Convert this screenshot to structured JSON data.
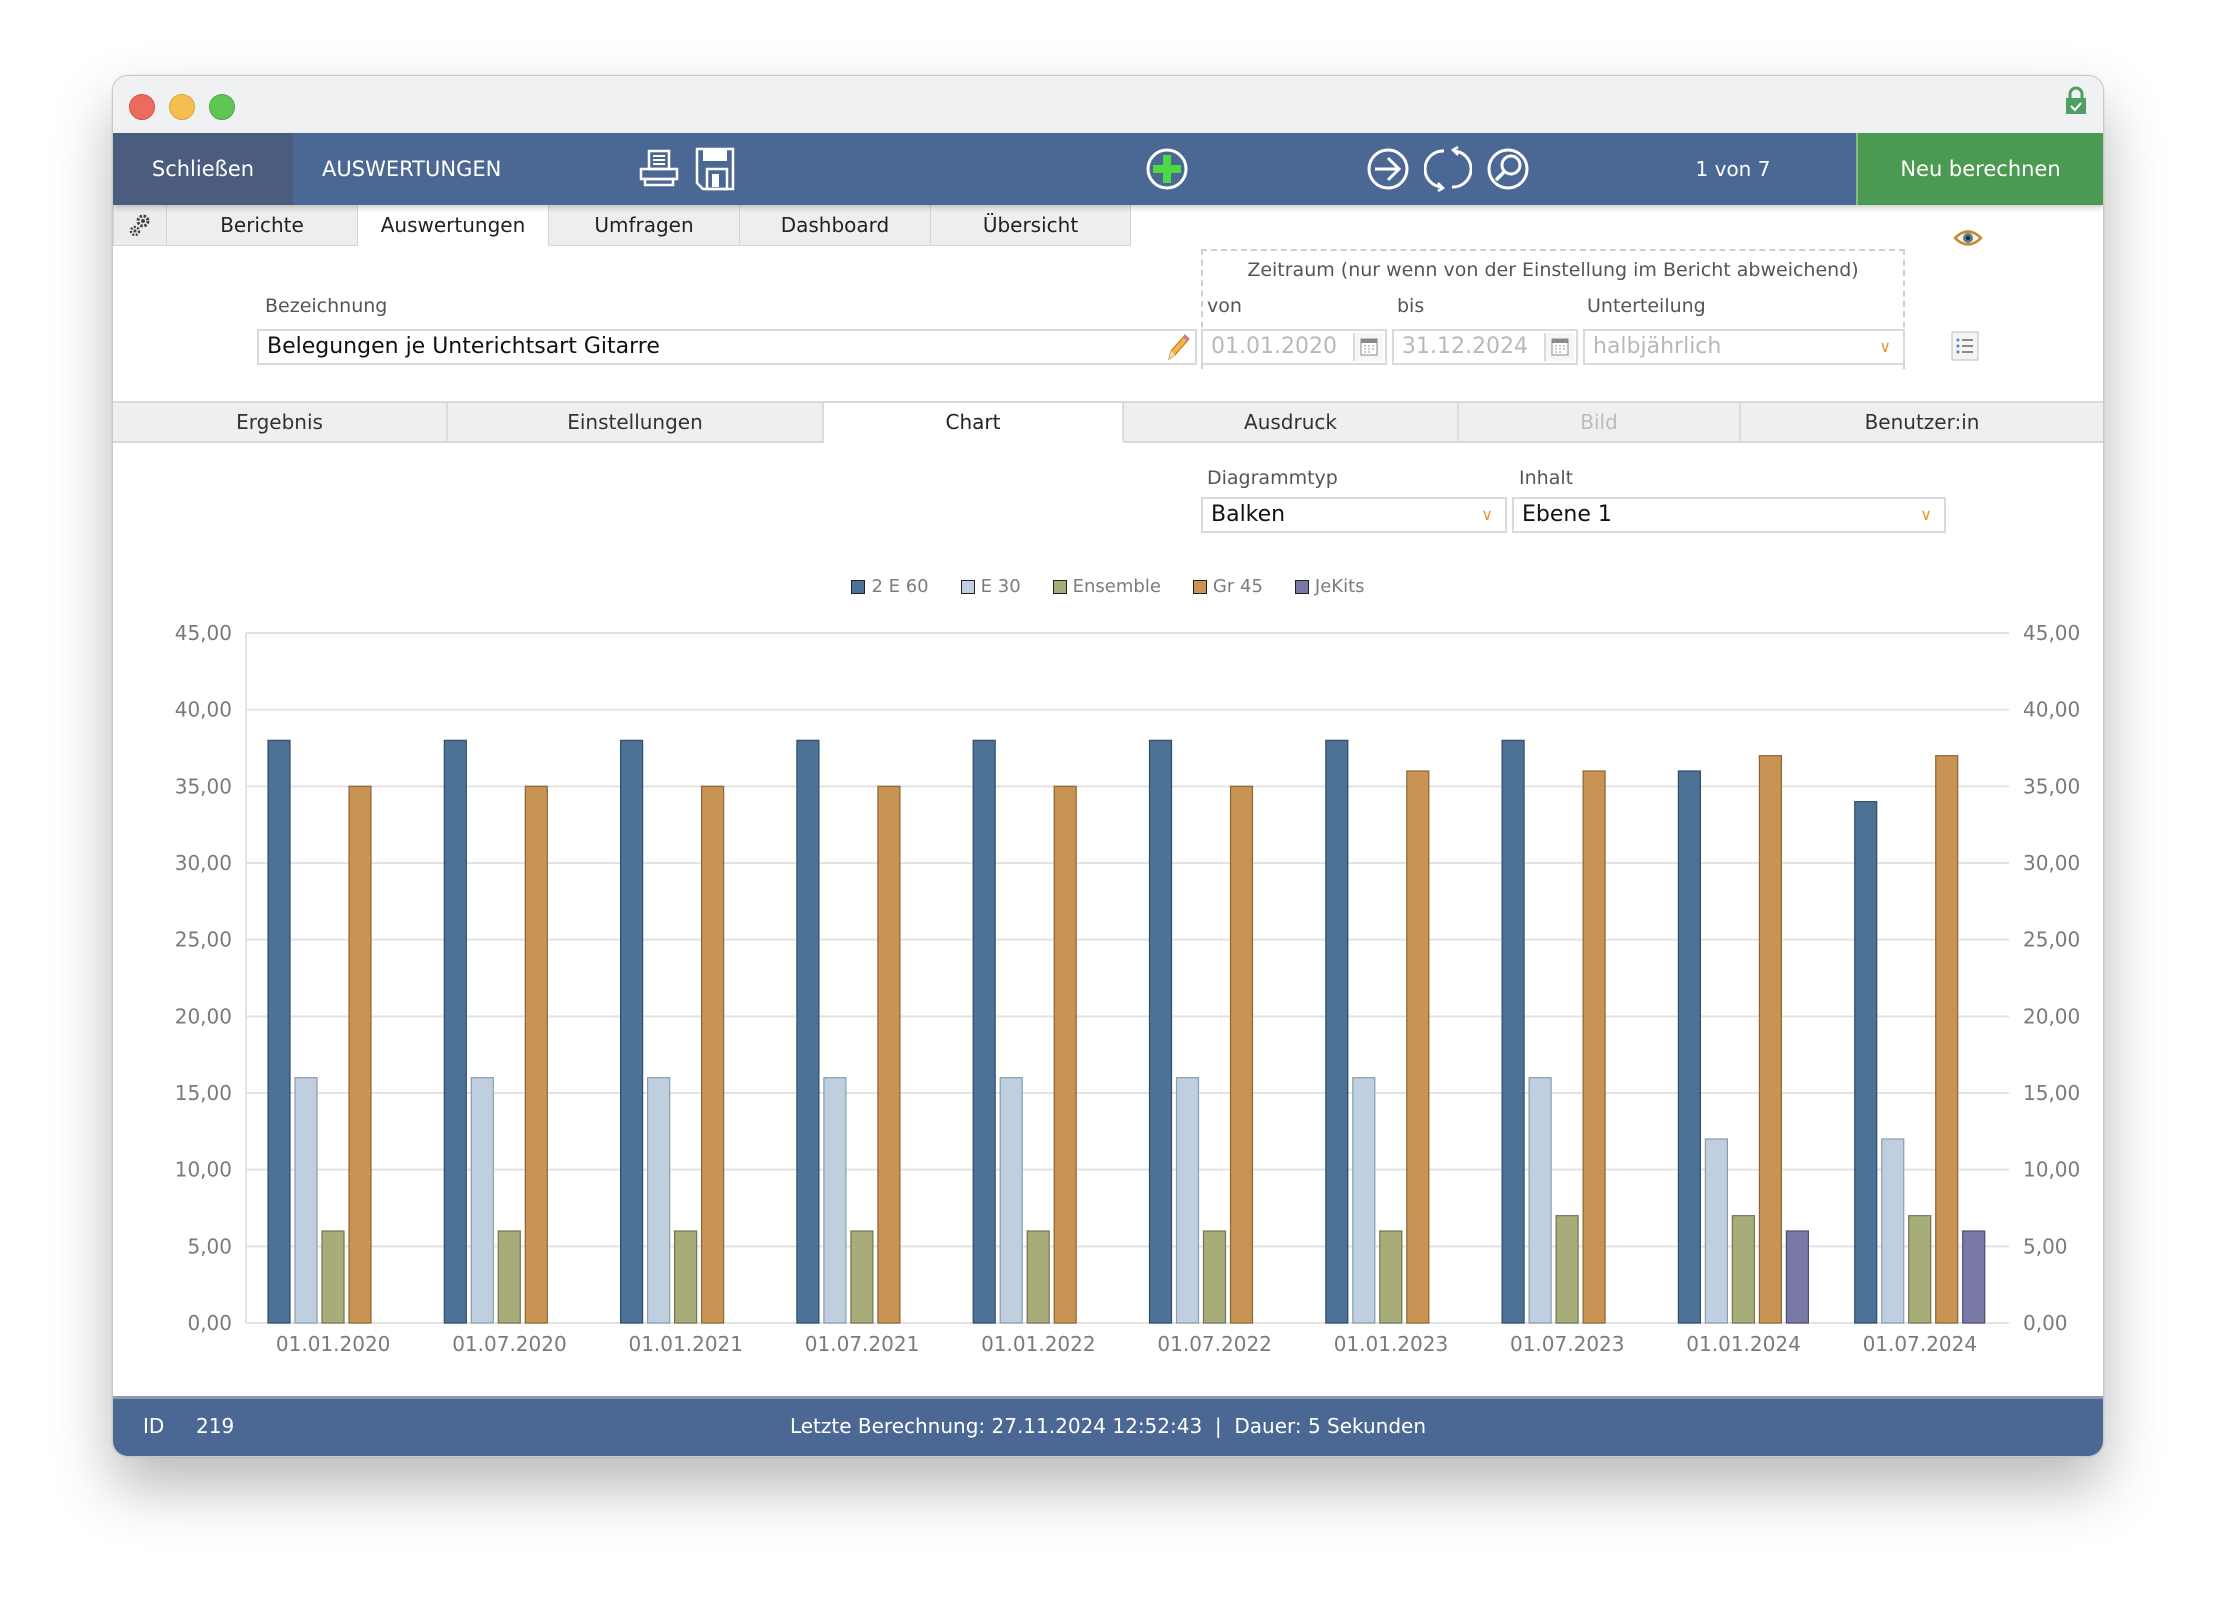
{
  "window": {
    "title_lock_icon": "lock-check-icon"
  },
  "toolbar": {
    "close_label": "Schließen",
    "title": "AUSWERTUNGEN",
    "icons": [
      "printer-icon",
      "save-icon",
      "add-icon",
      "forward-icon",
      "refresh-icon",
      "search-icon"
    ],
    "record_counter": "1 von 7",
    "recalc_label": "Neu berechnen"
  },
  "top_tabs": {
    "settings_icon": "gear-icon",
    "items": [
      {
        "label": "Berichte",
        "active": false
      },
      {
        "label": "Auswertungen",
        "active": true
      },
      {
        "label": "Umfragen",
        "active": false
      },
      {
        "label": "Dashboard",
        "active": false
      },
      {
        "label": "Übersicht",
        "active": false
      }
    ]
  },
  "form": {
    "bezeichnung_label": "Bezeichnung",
    "bezeichnung_value": "Belegungen je Unterichtsart Gitarre",
    "zeitraum_label": "Zeitraum (nur wenn von der Einstellung im Bericht abweichend)",
    "von_label": "von",
    "von_value": "01.01.2020",
    "bis_label": "bis",
    "bis_value": "31.12.2024",
    "unterteilung_label": "Unterteilung",
    "unterteilung_value": "halbjährlich"
  },
  "sub_tabs": {
    "items": [
      {
        "label": "Ergebnis",
        "active": false,
        "disabled": false
      },
      {
        "label": "Einstellungen",
        "active": false,
        "disabled": false
      },
      {
        "label": "Chart",
        "active": true,
        "disabled": false
      },
      {
        "label": "Ausdruck",
        "active": false,
        "disabled": false
      },
      {
        "label": "Bild",
        "active": false,
        "disabled": true
      },
      {
        "label": "Benutzer:in",
        "active": false,
        "disabled": false
      }
    ]
  },
  "chart_settings": {
    "diagrammtyp_label": "Diagrammtyp",
    "diagrammtyp_value": "Balken",
    "inhalt_label": "Inhalt",
    "inhalt_value": "Ebene 1"
  },
  "chart_data": {
    "type": "bar",
    "title": "",
    "xlabel": "",
    "ylabel": "",
    "ylim": [
      0,
      45
    ],
    "y_ticks": [
      "0,00",
      "5,00",
      "10,00",
      "15,00",
      "20,00",
      "25,00",
      "30,00",
      "35,00",
      "40,00",
      "45,00"
    ],
    "y_tick_values": [
      0,
      5,
      10,
      15,
      20,
      25,
      30,
      35,
      40,
      45
    ],
    "grid": true,
    "secondary_axis_mirrored": true,
    "legend_position": "top-center",
    "categories": [
      "01.01.2020",
      "01.07.2020",
      "01.01.2021",
      "01.07.2021",
      "01.01.2022",
      "01.07.2022",
      "01.01.2023",
      "01.07.2023",
      "01.01.2024",
      "01.07.2024"
    ],
    "series": [
      {
        "name": "2 E 60",
        "color": "#4c7396",
        "stroke": "#2f4d6b",
        "values": [
          38,
          38,
          38,
          38,
          38,
          38,
          38,
          38,
          36,
          34
        ]
      },
      {
        "name": "E 30",
        "color": "#bfcfdf",
        "stroke": "#8a9cad",
        "values": [
          16,
          16,
          16,
          16,
          16,
          16,
          16,
          16,
          12,
          12
        ]
      },
      {
        "name": "Ensemble",
        "color": "#a7ac78",
        "stroke": "#727650",
        "values": [
          6,
          6,
          6,
          6,
          6,
          6,
          6,
          7,
          7,
          7
        ]
      },
      {
        "name": "Gr 45",
        "color": "#c99353",
        "stroke": "#8c6634",
        "values": [
          35,
          35,
          35,
          35,
          35,
          35,
          36,
          36,
          37,
          37
        ]
      },
      {
        "name": "JeKits",
        "color": "#7879a6",
        "stroke": "#4c4d72",
        "values": [
          0,
          0,
          0,
          0,
          0,
          0,
          0,
          0,
          6,
          6
        ]
      }
    ]
  },
  "status_bar": {
    "id_label": "ID",
    "id_value": "219",
    "info": "Letzte Berechnung: 27.11.2024 12:52:43  |  Dauer: 5 Sekunden"
  }
}
